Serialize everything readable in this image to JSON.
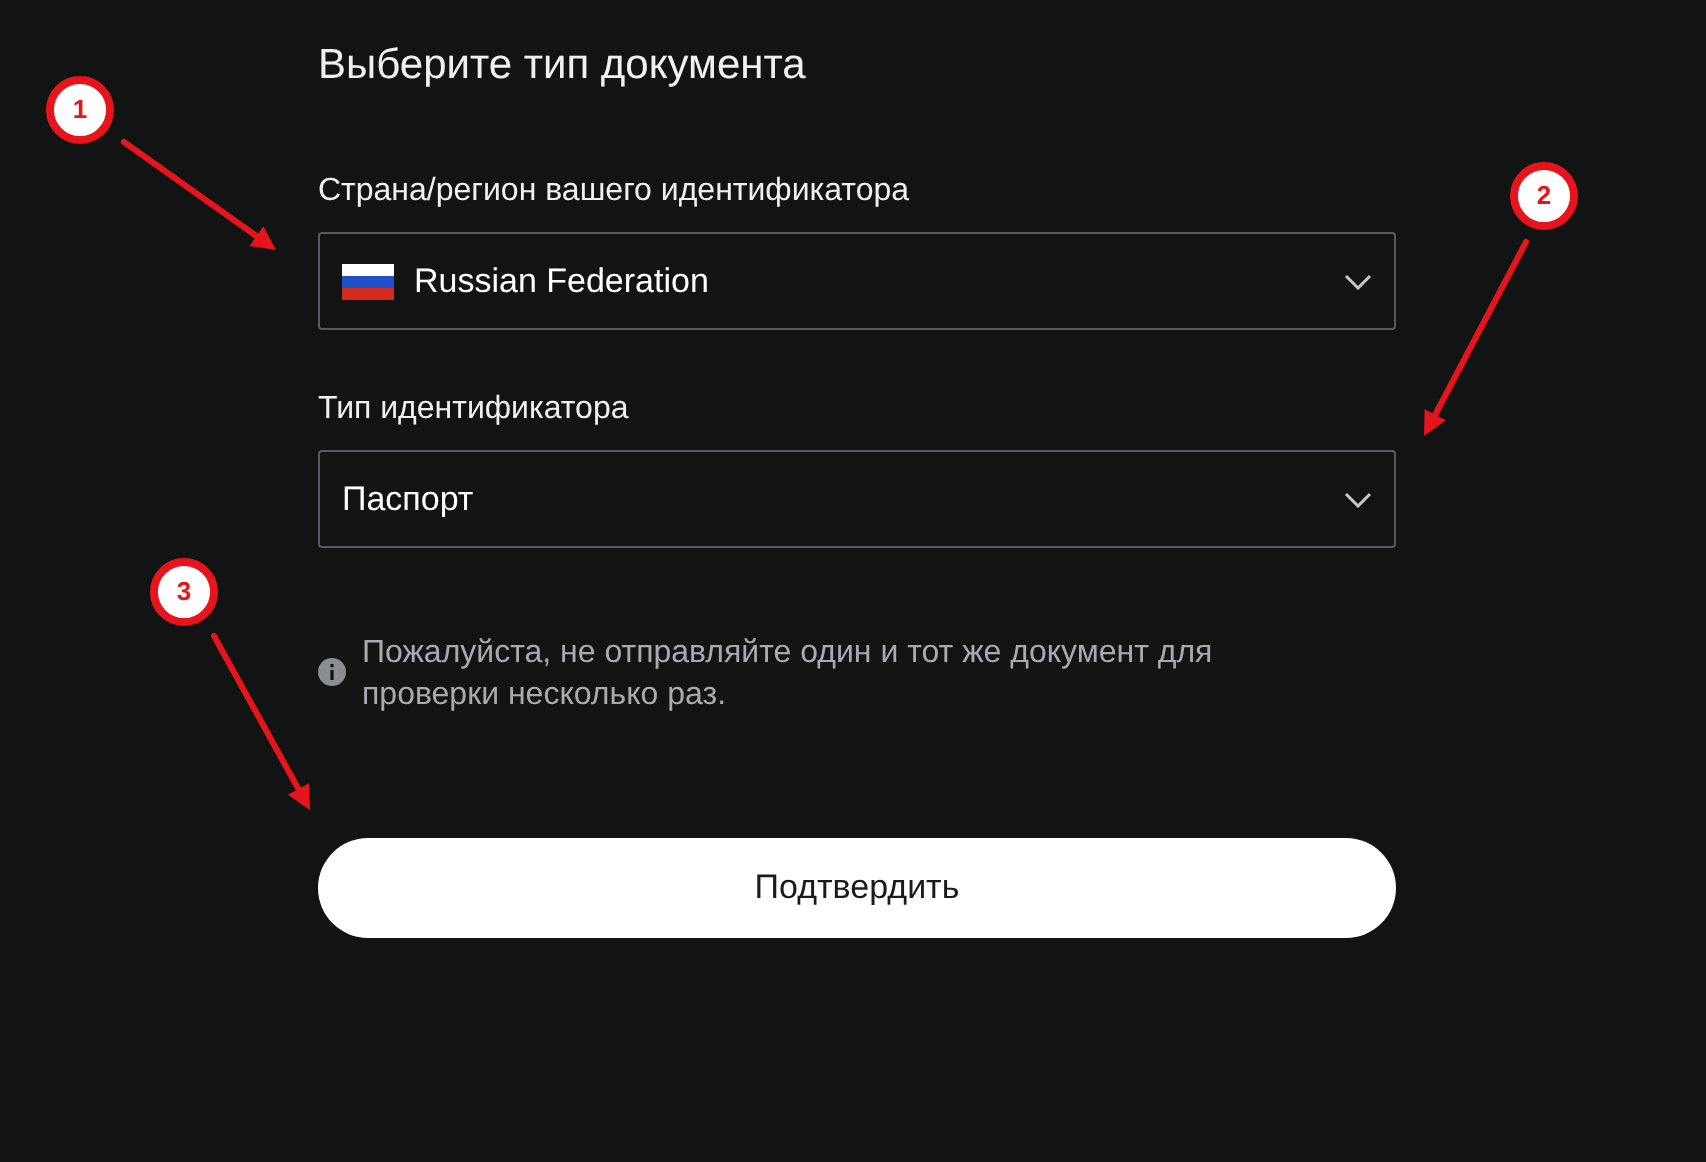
{
  "title": "Выберите тип документа",
  "fields": [
    {
      "kind": "country",
      "label": "Страна/регион вашего идентификатора",
      "value": "Russian Federation"
    },
    {
      "kind": "plain",
      "label": "Тип идентификатора",
      "value": "Паспорт"
    }
  ],
  "notice": "Пожалуйста, не отправляйте один и тот же документ для проверки несколько раз.",
  "submit_button": "Подтвердить",
  "annotations": [
    {
      "number": "1"
    },
    {
      "number": "2"
    },
    {
      "number": "3"
    }
  ]
}
